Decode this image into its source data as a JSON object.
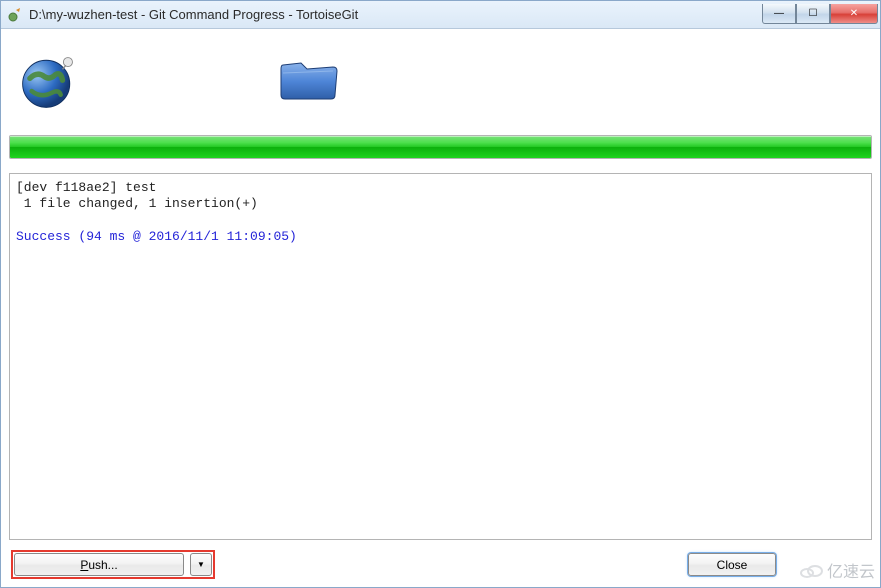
{
  "titlebar": {
    "title": "D:\\my-wuzhen-test - Git Command Progress - TortoiseGit"
  },
  "progress": {
    "percent": 100
  },
  "log": {
    "line1": "[dev f118ae2] test",
    "line2": " 1 file changed, 1 insertion(+)",
    "blank": "",
    "success": "Success (94 ms @ 2016/11/1 11:09:05)"
  },
  "buttons": {
    "push_label_prefix": "P",
    "push_label_rest": "ush...",
    "dropdown_glyph": "▼",
    "close_label": "Close"
  },
  "win_controls": {
    "min": "—",
    "max": "☐",
    "close": "✕"
  },
  "watermark": {
    "text": "亿速云"
  }
}
